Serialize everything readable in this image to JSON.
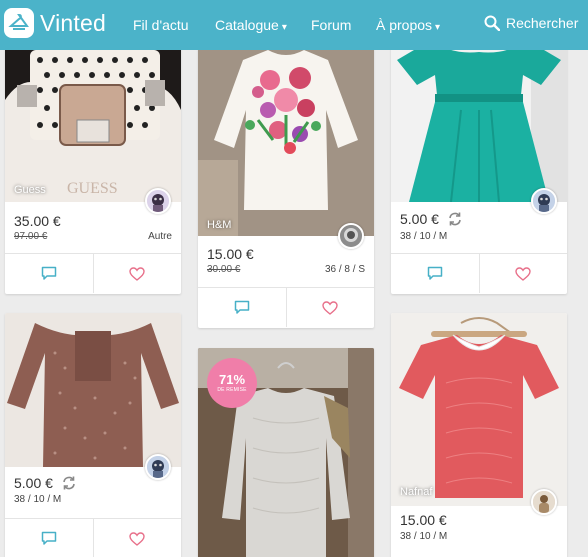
{
  "header": {
    "logo_text": "Vinted",
    "nav": [
      "Fil d'actu",
      "Catalogue",
      "Forum",
      "À propos"
    ],
    "search_label": "Rechercher"
  },
  "items": [
    {
      "brand": "Guess",
      "price": "35.00 €",
      "old_price": "97.00 €",
      "size": "Autre"
    },
    {
      "brand": "H&M",
      "price": "15.00 €",
      "old_price": "30.00 €",
      "size": "36 / 8 / S"
    },
    {
      "brand": "",
      "price": "5.00 €",
      "size": "38 / 10 / M"
    },
    {
      "brand": "",
      "price": "5.00 €",
      "size": "38 / 10 / M"
    },
    {
      "discount_pct": "71%",
      "discount_label": "DE REMISE"
    },
    {
      "brand": "Nafnaf",
      "price": "15.00 €",
      "size": "38 / 10 / M"
    }
  ],
  "colors": {
    "accent": "#4bb3c9",
    "icon": "#47b0c7",
    "heart": "#e8708a",
    "discount": "#f07ea9"
  }
}
